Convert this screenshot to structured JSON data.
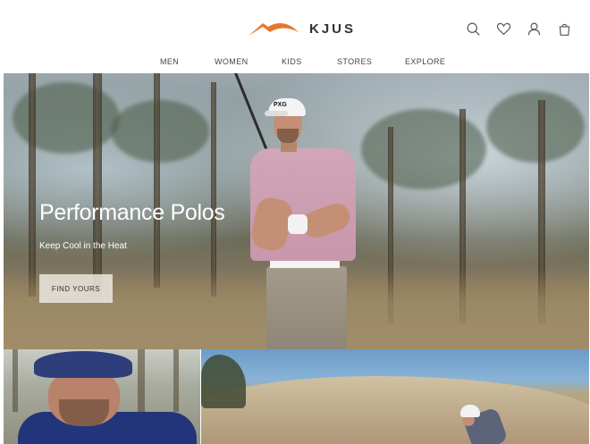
{
  "header": {
    "brand": "KJUS",
    "logo_color": "#e8782a",
    "icons": [
      "search-icon",
      "heart-icon",
      "user-icon",
      "bag-icon"
    ]
  },
  "nav": {
    "items": [
      {
        "label": "MEN"
      },
      {
        "label": "WOMEN"
      },
      {
        "label": "KIDS"
      },
      {
        "label": "STORES"
      },
      {
        "label": "EXPLORE"
      }
    ]
  },
  "hero": {
    "title": "Performance Polos",
    "subtitle": "Keep Cool in the Heat",
    "button_label": "FIND YOURS",
    "cap_logo": "PXG"
  }
}
